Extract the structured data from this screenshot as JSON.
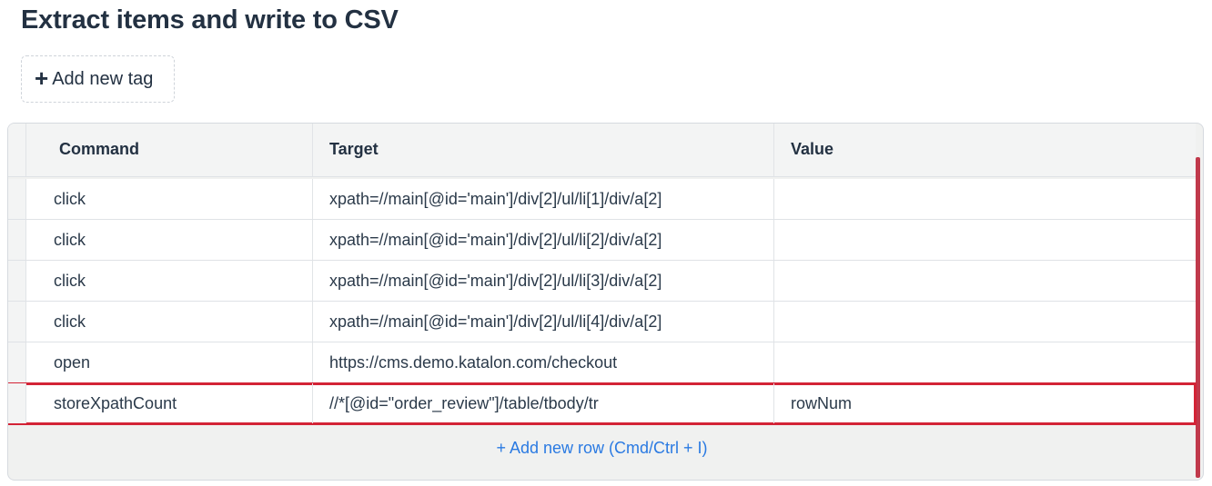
{
  "title": "Extract items and write to CSV",
  "add_tag": {
    "icon": "plus-icon",
    "label": "Add new tag"
  },
  "table": {
    "headers": {
      "command": "Command",
      "target": "Target",
      "value": "Value"
    },
    "rows": [
      {
        "command": "click",
        "target": "xpath=//main[@id='main']/div[2]/ul/li[1]/div/a[2]",
        "value": ""
      },
      {
        "command": "click",
        "target": "xpath=//main[@id='main']/div[2]/ul/li[2]/div/a[2]",
        "value": ""
      },
      {
        "command": "click",
        "target": "xpath=//main[@id='main']/div[2]/ul/li[3]/div/a[2]",
        "value": ""
      },
      {
        "command": "click",
        "target": "xpath=//main[@id='main']/div[2]/ul/li[4]/div/a[2]",
        "value": ""
      },
      {
        "command": "open",
        "target": "https://cms.demo.katalon.com/checkout",
        "value": ""
      },
      {
        "command": "storeXpathCount",
        "target": "//*[@id=\"order_review\"]/table/tbody/tr",
        "value": "rowNum",
        "selected": true
      }
    ],
    "add_row_label": "+ Add new row (Cmd/Ctrl + I)"
  },
  "colors": {
    "title": "#233142",
    "link": "#2a7ae2",
    "selection_border": "#d32336",
    "scrollbar": "#c0394b"
  }
}
